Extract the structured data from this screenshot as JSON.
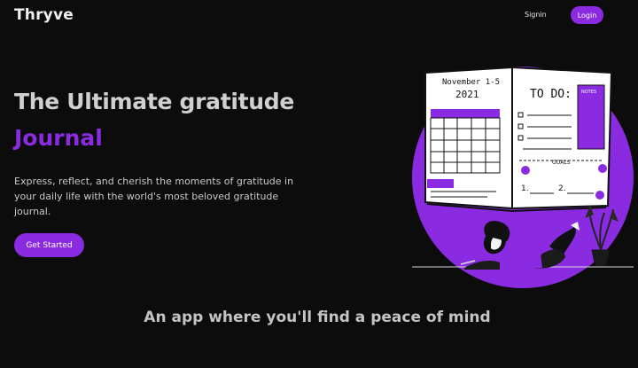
{
  "nav": {
    "brand": "Thryve",
    "signin_label": "Signin",
    "login_label": "Login"
  },
  "hero": {
    "title": "The Ultimate gratitude",
    "title_accent": "Journal",
    "description": "Express, reflect, and cherish the moments of gratitude in your daily life with the world's most beloved gratitude journal.",
    "cta_label": "Get Started"
  },
  "illustration": {
    "journal_date_line1": "November 1-5",
    "journal_date_line2": "2021",
    "journal_todo": "TO DO:",
    "journal_goals": "GOALS",
    "journal_notes": "NOTES",
    "icon": "woman-journaling-illustration"
  },
  "tagline": "An app where you'll find a peace of mind",
  "colors": {
    "background": "#0d0c0d",
    "accent": "#8a2be2",
    "text": "#f2f2f2",
    "muted_text": "#c9c9c9"
  }
}
